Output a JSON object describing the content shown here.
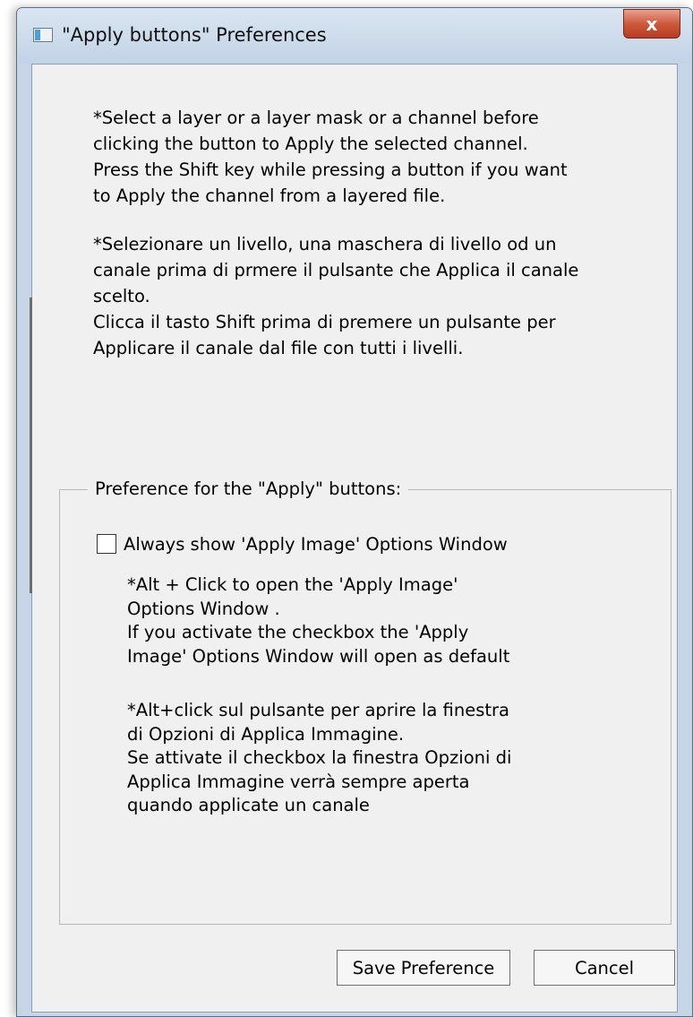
{
  "window": {
    "title": "\"Apply buttons\" Preferences",
    "close_label": "x"
  },
  "info": {
    "english": "*Select a layer or a layer mask or a channel before\nclicking the button to Apply the selected channel.\nPress the Shift key while pressing a button if you want\nto Apply the channel from a layered file.",
    "italian": "*Selezionare un livello, una maschera di livello od un\ncanale prima di prmere il pulsante  che Applica il canale\nscelto.\nClicca il tasto Shift prima di premere un pulsante per\nApplicare il canale dal file con tutti i livelli."
  },
  "preferences": {
    "group_label": "Preference for the \"Apply\" buttons:",
    "checkbox_label": "Always show 'Apply Image' Options Window",
    "checkbox_checked": false,
    "hint_english": "*Alt + Click to open the 'Apply Image'\nOptions Window .\nIf you activate the checkbox the 'Apply\nImage' Options Window will open as default",
    "hint_italian": "*Alt+click sul pulsante per aprire la finestra\ndi Opzioni di Applica Immagine.\nSe attivate il checkbox la finestra Opzioni di\nApplica Immagine verrà sempre aperta\nquando applicate un canale"
  },
  "buttons": {
    "save": "Save Preference",
    "cancel": "Cancel"
  }
}
